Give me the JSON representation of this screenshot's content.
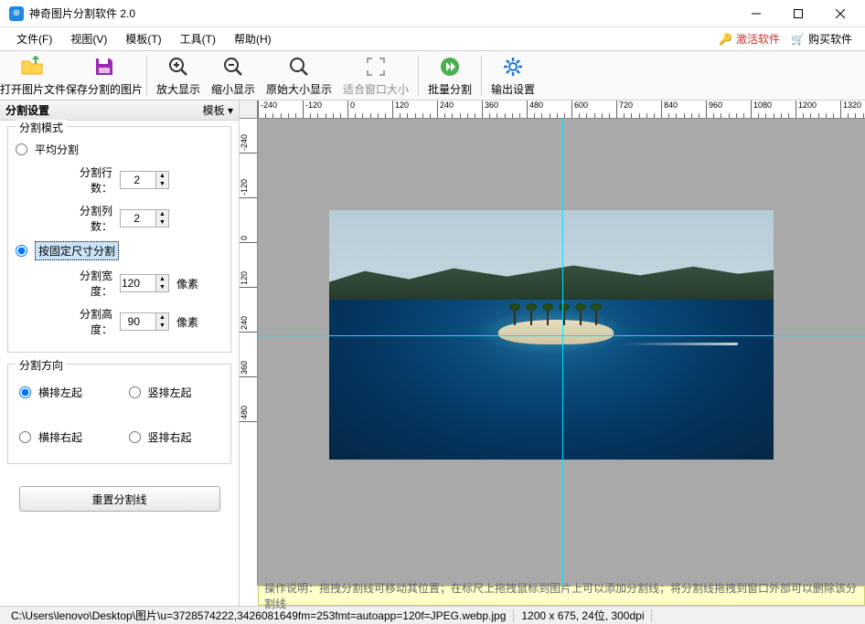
{
  "title": "神奇图片分割软件 2.0",
  "menu": {
    "file": "文件(F)",
    "view": "视图(V)",
    "template": "模板(T)",
    "tools": "工具(T)",
    "help": "帮助(H)",
    "activate": "激活软件",
    "buy": "购买软件"
  },
  "toolbar": {
    "open": "打开图片文件",
    "save": "保存分割的图片",
    "zoom_in": "放大显示",
    "zoom_out": "缩小显示",
    "zoom_orig": "原始大小显示",
    "zoom_fit": "适合窗口大小",
    "batch": "批量分割",
    "output": "输出设置"
  },
  "sidebar": {
    "title": "分割设置",
    "template_label": "模板",
    "mode_group": "分割模式",
    "avg_split": "平均分割",
    "split_rows_label": "分割行数：",
    "split_rows_value": "2",
    "split_cols_label": "分割列数：",
    "split_cols_value": "2",
    "fixed_split": "按固定尺寸分割",
    "split_w_label": "分割宽度：",
    "split_w_value": "120",
    "split_h_label": "分割高度：",
    "split_h_value": "90",
    "pixel_unit": "像素",
    "dir_group": "分割方向",
    "dir_hl": "横排左起",
    "dir_vl": "竖排左起",
    "dir_hr": "横排右起",
    "dir_vr": "竖排右起",
    "reset": "重置分割线"
  },
  "hint": "操作说明：拖拽分割线可移动其位置；在标尺上拖拽鼠标到图片上可以添加分割线；将分割线拖拽到窗口外部可以删除该分割线",
  "status": {
    "path": "C:\\Users\\lenovo\\Desktop\\图片\\u=3728574222,3426081649fm=253fmt=autoapp=120f=JPEG.webp.jpg",
    "info": "1200 x 675, 24位, 300dpi"
  },
  "ruler_h_ticks": [
    -240,
    -120,
    0,
    120,
    240,
    360,
    480,
    600,
    720,
    840,
    960,
    1080,
    1200,
    1320
  ],
  "ruler_v_ticks": [
    -240,
    -120,
    0,
    120,
    240,
    360,
    480
  ]
}
